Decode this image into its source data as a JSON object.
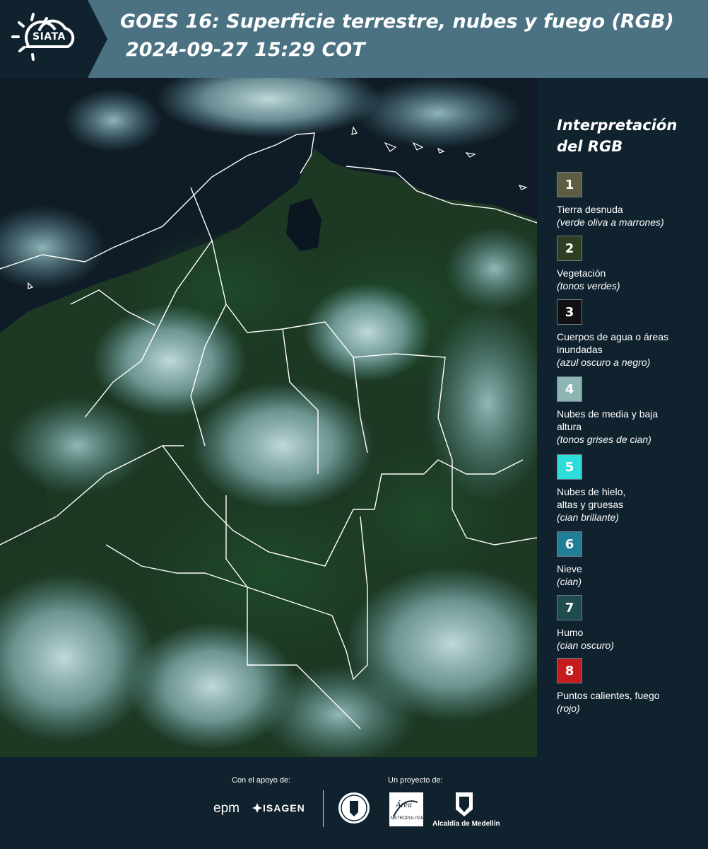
{
  "header": {
    "logo_text": "SIATA",
    "title": "GOES 16: Superficie terrestre, nubes y fuego (RGB)",
    "subtitle": "2024-09-27 15:29 COT"
  },
  "legend": {
    "title": "Interpretación del RGB",
    "items": [
      {
        "number": "1",
        "label": "Tierra desnuda",
        "note": "(verde oliva a marrones)",
        "color": "#5e5d44"
      },
      {
        "number": "2",
        "label": "Vegetación",
        "note": "(tonos verdes)",
        "color": "#2d3f20"
      },
      {
        "number": "3",
        "label": "Cuerpos de agua o áreas inundadas",
        "note": "(azul oscuro a negro)",
        "color": "#111114"
      },
      {
        "number": "4",
        "label": "Nubes de media y baja altura",
        "note": "(tonos grises de cian)",
        "color": "#8fb4b4"
      },
      {
        "number": "5",
        "label": "Nubes de hielo, altas y gruesas",
        "note": "(cian brillante)",
        "color": "#2fdcdc"
      },
      {
        "number": "6",
        "label": "Nieve",
        "note": "(cian)",
        "color": "#207e96"
      },
      {
        "number": "7",
        "label": "Humo",
        "note": "(cian oscuro)",
        "color": "#1f4d4e"
      },
      {
        "number": "8",
        "label": "Puntos calientes, fuego",
        "note": "(rojo)",
        "color": "#c41c1c"
      }
    ]
  },
  "footer": {
    "support_label": "Con el apoyo de:",
    "project_label": "Un proyecto de:",
    "epm": "epm",
    "isagen": "ISAGEN",
    "area_text": "Área",
    "area_sub": "METROPOLITANA",
    "alcaldia": "Alcaldía de Medellín"
  }
}
